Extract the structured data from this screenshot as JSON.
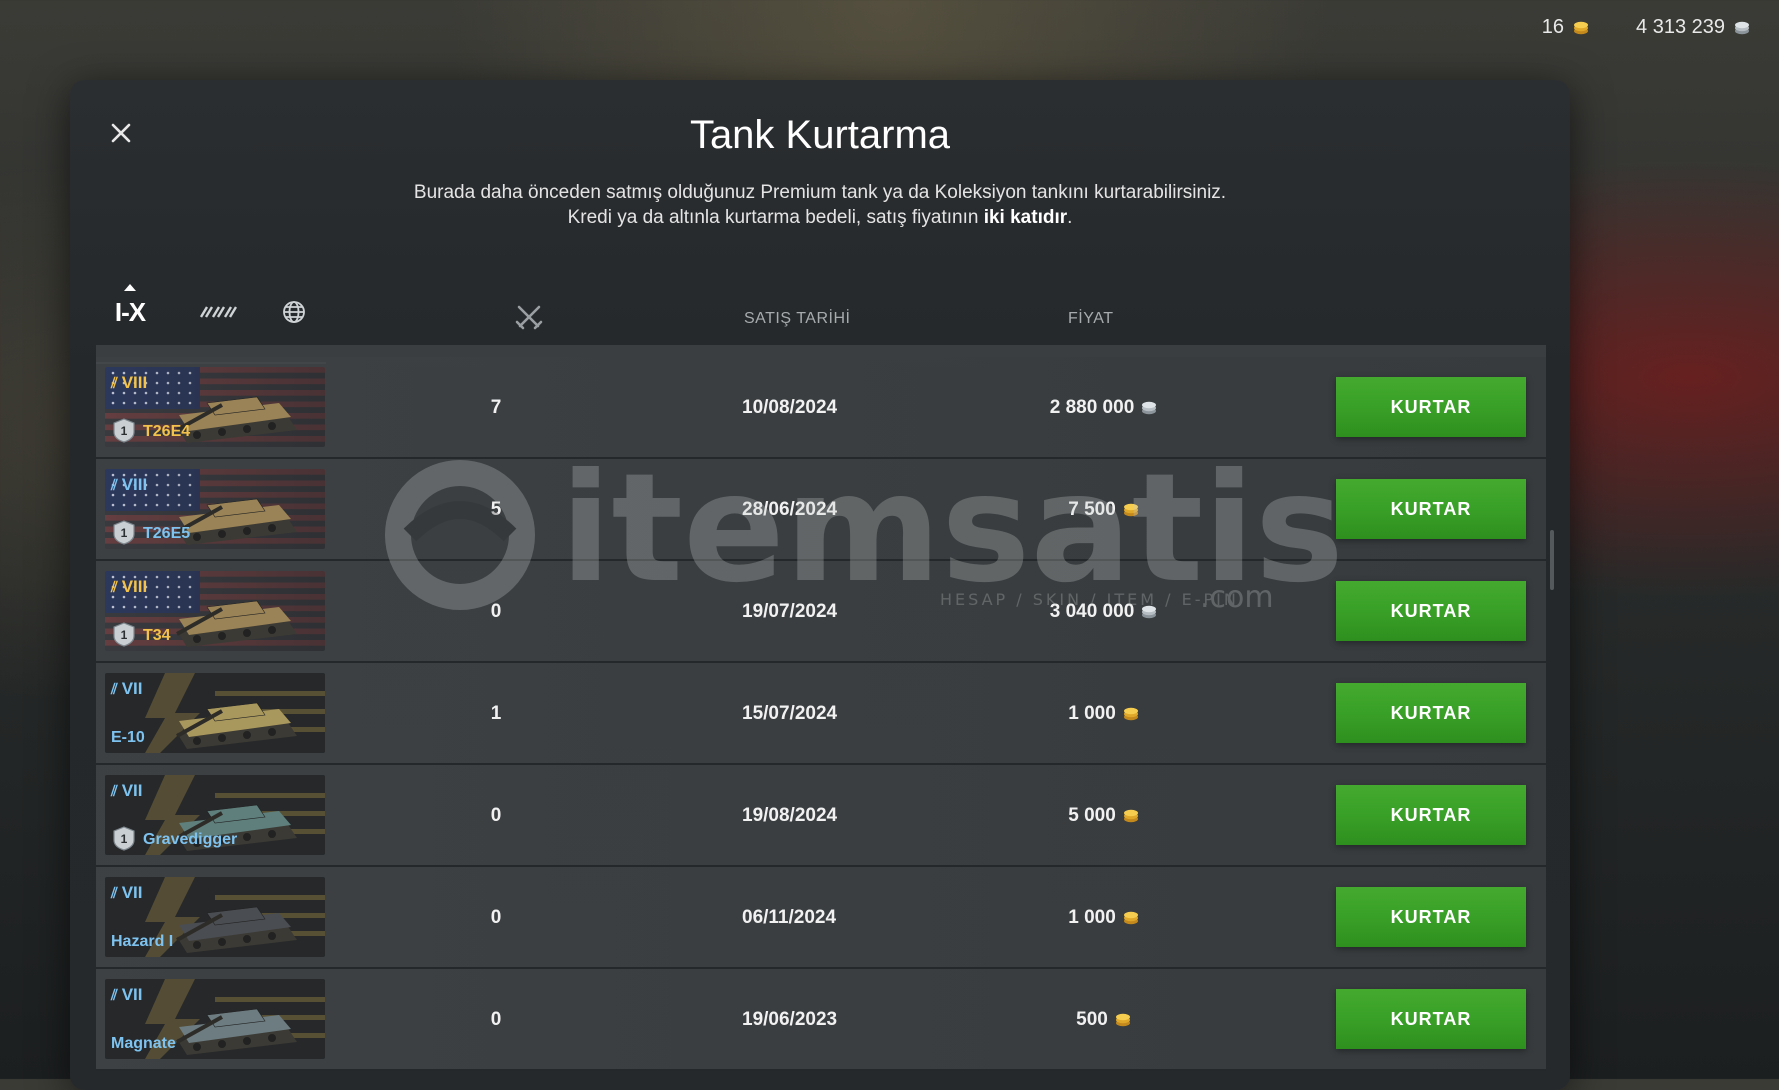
{
  "currency": {
    "gold": "16",
    "credits": "4 313 239",
    "gold_icon": "gold-coin-icon",
    "credits_icon": "silver-credits-icon"
  },
  "dialog": {
    "title": "Tank Kurtarma",
    "description_line1": "Burada daha önceden satmış olduğunuz Premium tank ya da Koleksiyon tankını kurtarabilirsiniz.",
    "description_line2_prefix": "Kredi ya da altınla kurtarma bedeli, satış fiyatının ",
    "description_line2_bold": "iki katıdır",
    "description_line2_suffix": "."
  },
  "filters": {
    "tier_label": "I-X",
    "type_icon": "tank-type-icon",
    "nation_icon": "globe-icon"
  },
  "columns": {
    "battles_icon": "crossed-swords-icon",
    "date": "SATIŞ TARİHİ",
    "price": "FİYAT"
  },
  "watermark": {
    "brand": "itemsatis",
    "tagline": "HESAP / SKIN / ITEM / E-PIN",
    "suffix": ".com"
  },
  "rows": [
    {
      "tier": "VIII",
      "name": "T26E4",
      "name_color": "gold",
      "badge": "1",
      "battles": "7",
      "date": "10/08/2024",
      "price": "2 880 000",
      "currency": "credits",
      "button": "KURTAR",
      "flag": "usa"
    },
    {
      "tier": "VIII",
      "name": "T26E5",
      "name_color": "blue",
      "badge": "1",
      "battles": "5",
      "date": "28/06/2024",
      "price": "7 500",
      "currency": "gold",
      "button": "KURTAR",
      "flag": "usa"
    },
    {
      "tier": "VIII",
      "name": "T34",
      "name_color": "gold",
      "badge": "1",
      "battles": "0",
      "date": "19/07/2024",
      "price": "3 040 000",
      "currency": "credits",
      "button": "KURTAR",
      "flag": "usa"
    },
    {
      "tier": "VII",
      "name": "E-10",
      "name_color": "blue",
      "badge": "",
      "battles": "1",
      "date": "15/07/2024",
      "price": "1 000",
      "currency": "gold",
      "button": "KURTAR",
      "flag": "collection"
    },
    {
      "tier": "VII",
      "name": "Gravedigger",
      "name_color": "blue",
      "badge": "1",
      "battles": "0",
      "date": "19/08/2024",
      "price": "5 000",
      "currency": "gold",
      "button": "KURTAR",
      "flag": "collection"
    },
    {
      "tier": "VII",
      "name": "Hazard I",
      "name_color": "blue",
      "badge": "",
      "battles": "0",
      "date": "06/11/2024",
      "price": "1 000",
      "currency": "gold",
      "button": "KURTAR",
      "flag": "collection"
    },
    {
      "tier": "VII",
      "name": "Magnate",
      "name_color": "blue",
      "badge": "",
      "battles": "0",
      "date": "19/06/2023",
      "price": "500",
      "currency": "gold",
      "button": "KURTAR",
      "flag": "collection"
    }
  ],
  "colors": {
    "button_green": "#3aa12a",
    "tier_gold": "#f2c24a",
    "tier_blue": "#7ec3f0"
  }
}
